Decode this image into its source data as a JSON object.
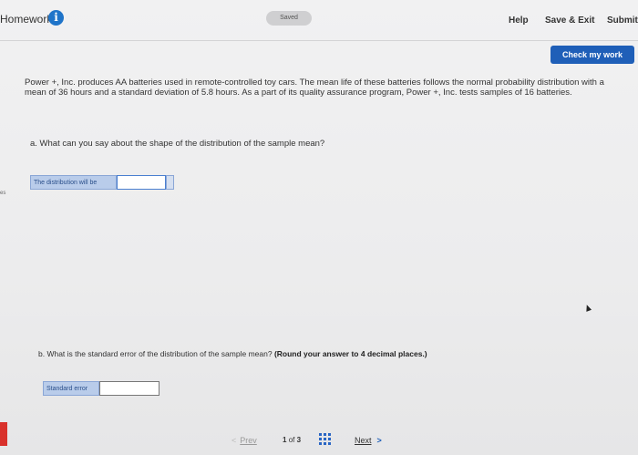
{
  "header": {
    "title": "Homework",
    "status": "Saved",
    "help": "Help",
    "save_exit": "Save & Exit",
    "submit": "Submit"
  },
  "check_button": "Check my work",
  "question_text": "Power +, Inc. produces AA batteries used in remote-controlled toy cars. The mean life of these batteries follows the normal probability distribution with a mean of 36 hours and a standard deviation of 5.8 hours. As a part of its quality assurance program, Power +, Inc. tests samples of 16 batteries.",
  "part_a": {
    "question": "a. What can you say about the shape of the distribution of the sample mean?",
    "input_label": "The distribution will be",
    "input_value": ""
  },
  "side_mark": "es",
  "part_b": {
    "question": "b. What is the standard error of the distribution of the sample mean?",
    "instruction": "(Round your answer to 4 decimal places.)",
    "input_label": "Standard error",
    "input_value": ""
  },
  "footer": {
    "prev": "Prev",
    "current_page": "1",
    "of": "of",
    "total_pages": "3",
    "next": "Next"
  },
  "colors": {
    "accent": "#1f5fb8",
    "info": "#1f74c9",
    "red_tab": "#d9312b"
  }
}
